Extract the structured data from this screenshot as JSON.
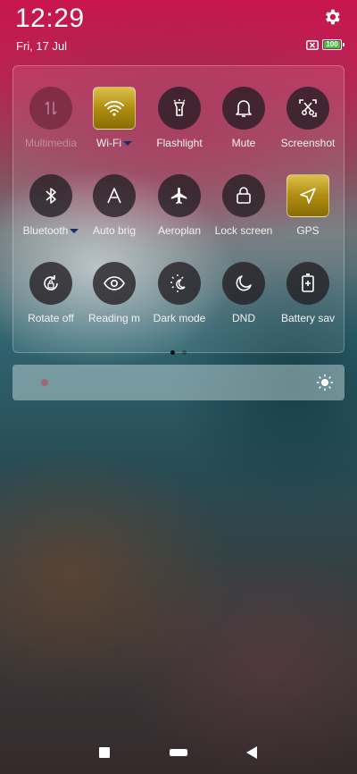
{
  "status": {
    "time": "12:29",
    "date": "Fri, 17 Jul",
    "battery_level": "100",
    "battery_color": "#3ec13c"
  },
  "quick_settings": {
    "tiles": [
      {
        "label": "Multimedia",
        "icon": "data-transfer-icon",
        "active": false,
        "dim": true
      },
      {
        "label": "Wi-Fi",
        "icon": "wifi-icon",
        "active": true
      },
      {
        "label": "Flashlight",
        "icon": "flashlight-icon",
        "active": false
      },
      {
        "label": "Mute",
        "icon": "bell-icon",
        "active": false
      },
      {
        "label": "Screenshot",
        "icon": "scissors-icon",
        "active": false
      },
      {
        "label": "Bluetooth",
        "icon": "bluetooth-icon",
        "active": false
      },
      {
        "label": "Auto brig",
        "icon": "auto-brightness-icon",
        "active": false
      },
      {
        "label": "Aeroplan",
        "icon": "airplane-icon",
        "active": false
      },
      {
        "label": "Lock screen",
        "icon": "lock-icon",
        "active": false
      },
      {
        "label": "GPS",
        "icon": "navigation-arrow-icon",
        "active": true
      },
      {
        "label": "Rotate off",
        "icon": "rotate-lock-icon",
        "active": false
      },
      {
        "label": "Reading m",
        "icon": "eye-icon",
        "active": false
      },
      {
        "label": "Dark mode",
        "icon": "dark-mode-icon",
        "active": false
      },
      {
        "label": "DND",
        "icon": "moon-icon",
        "active": false
      },
      {
        "label": "Battery sav",
        "icon": "battery-saver-icon",
        "active": false
      }
    ],
    "page_indicator": {
      "current": 1,
      "total": 2
    },
    "active_color": "#b08d10"
  },
  "brightness": {
    "level": 0.05
  }
}
